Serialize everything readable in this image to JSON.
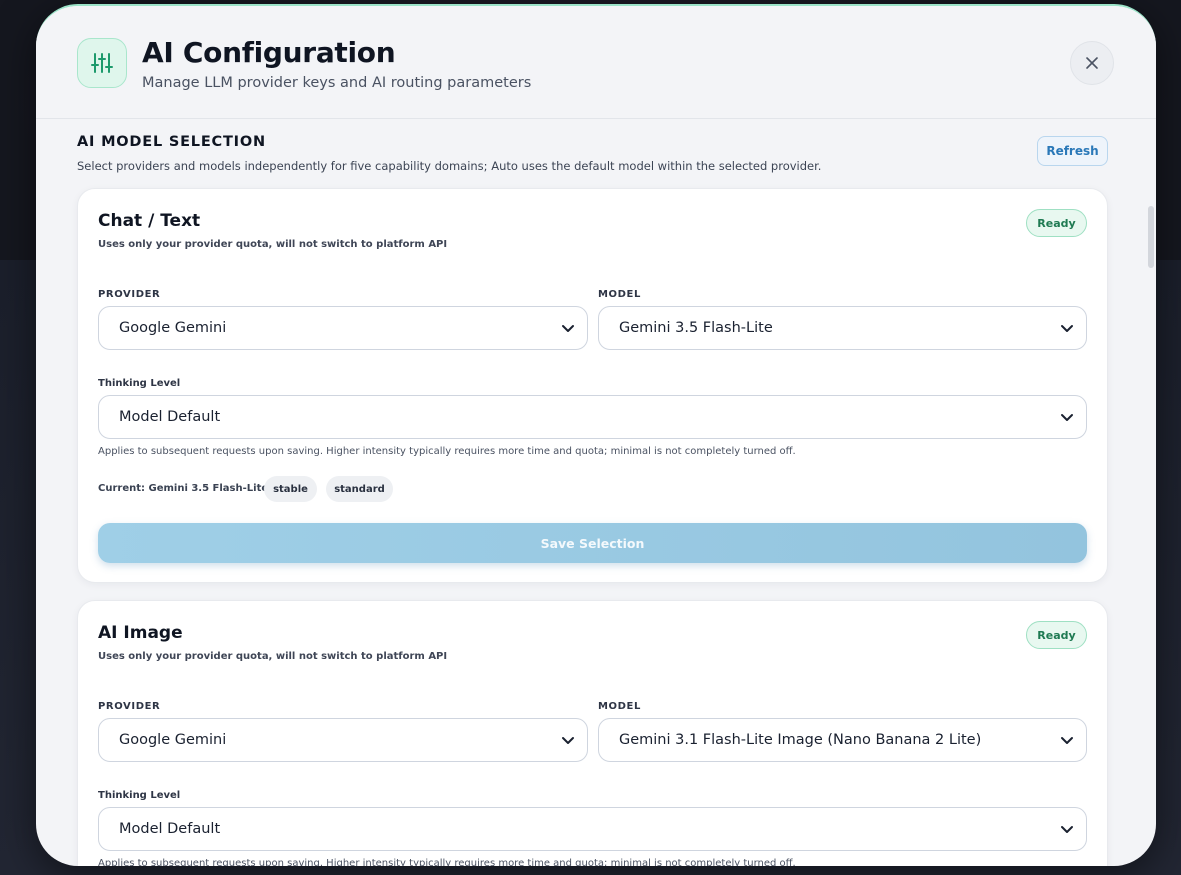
{
  "modal": {
    "title": "AI Configuration",
    "subtitle": "Manage LLM provider keys and AI routing parameters"
  },
  "section": {
    "title": "AI MODEL SELECTION",
    "description": "Select providers and models independently for five capability domains; Auto uses the default model within the selected provider.",
    "refresh_label": "Refresh"
  },
  "cards": [
    {
      "title": "Chat / Text",
      "note": "Uses only your provider quota, will not switch to platform API",
      "status": "Ready",
      "provider_label": "PROVIDER",
      "provider_value": "Google Gemini",
      "model_label": "MODEL",
      "model_value": "Gemini 3.5 Flash-Lite",
      "thinking_label": "Thinking Level",
      "thinking_value": "Model Default",
      "help": "Applies to subsequent requests upon saving. Higher intensity typically requires more time and quota; minimal is not completely turned off.",
      "current": "Current: Gemini 3.5 Flash-Lite",
      "tags": [
        "stable",
        "standard"
      ],
      "save_label": "Save Selection"
    },
    {
      "title": "AI Image",
      "note": "Uses only your provider quota, will not switch to platform API",
      "status": "Ready",
      "provider_label": "PROVIDER",
      "provider_value": "Google Gemini",
      "model_label": "MODEL",
      "model_value": "Gemini 3.1 Flash-Lite Image (Nano Banana 2 Lite)",
      "thinking_label": "Thinking Level",
      "thinking_value": "Model Default",
      "help": "Applies to subsequent requests upon saving. Higher intensity typically requires more time and quota; minimal is not completely turned off."
    }
  ]
}
